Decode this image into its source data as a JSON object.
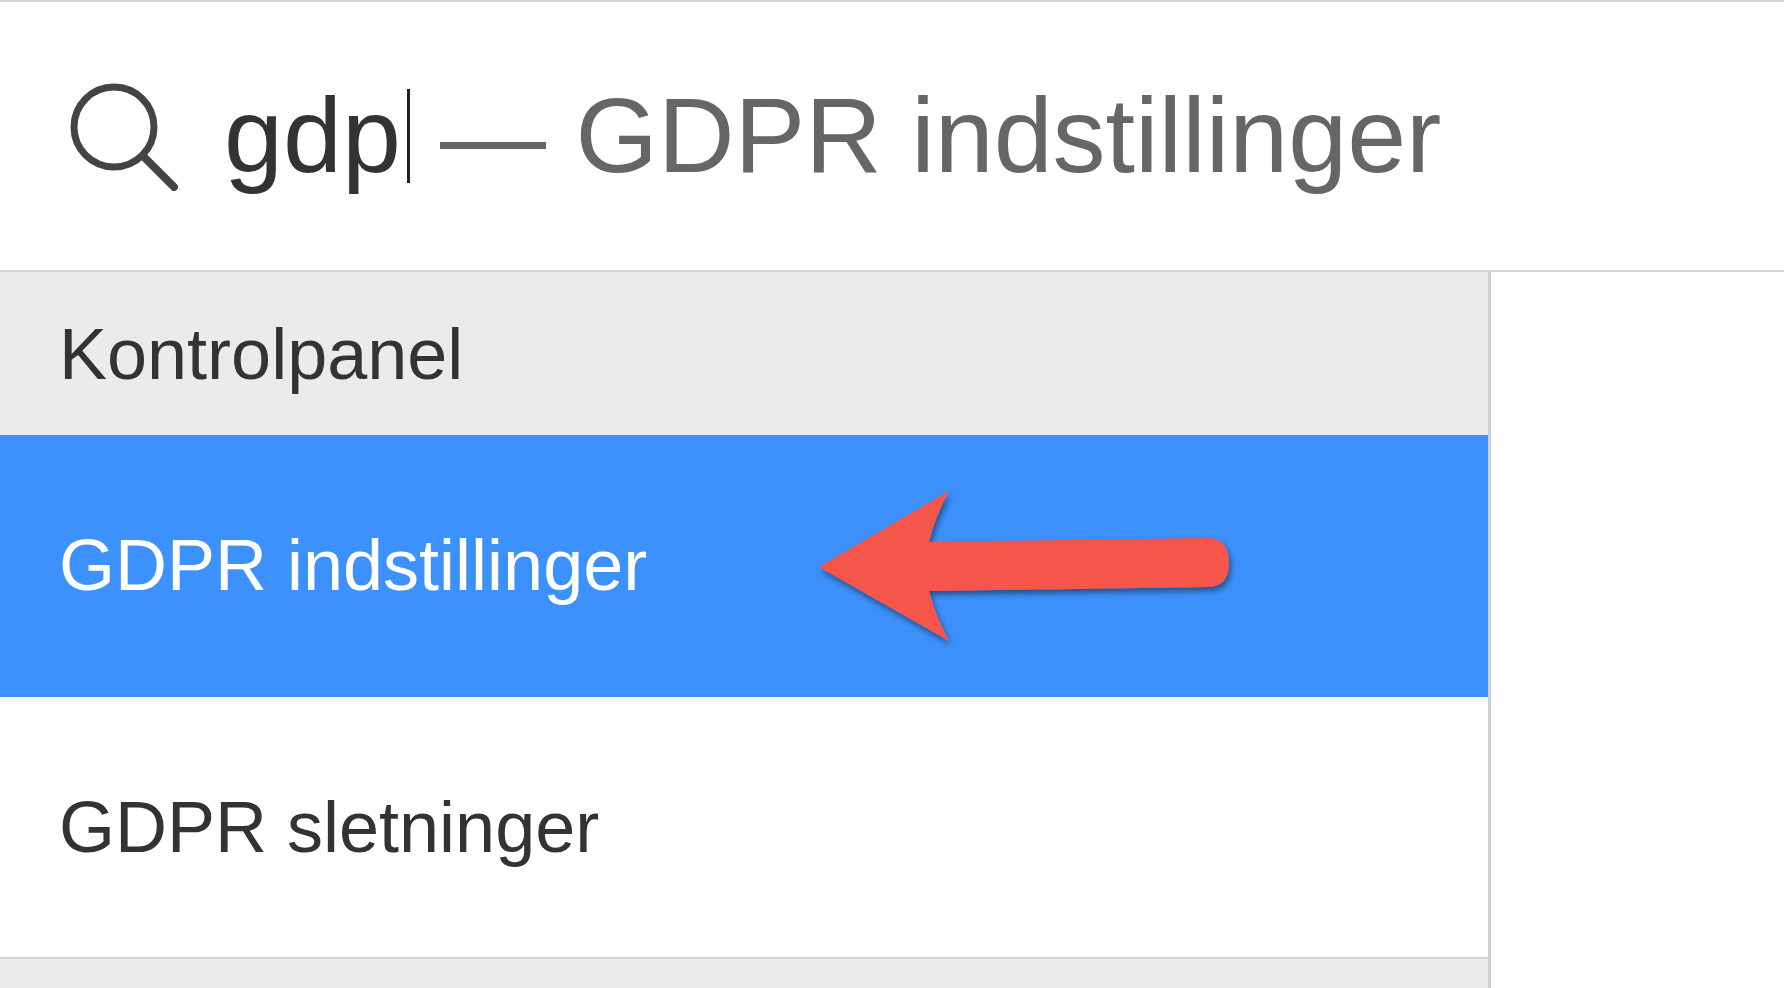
{
  "search": {
    "value": "gdp",
    "suggestion": "— GDPR indstillinger"
  },
  "results": [
    {
      "kind": "header",
      "label": "Kontrolpanel"
    },
    {
      "kind": "item",
      "label": "GDPR indstillinger",
      "selected": true
    },
    {
      "kind": "item",
      "label": "GDPR sletninger",
      "selected": false
    },
    {
      "kind": "header"
    }
  ]
}
